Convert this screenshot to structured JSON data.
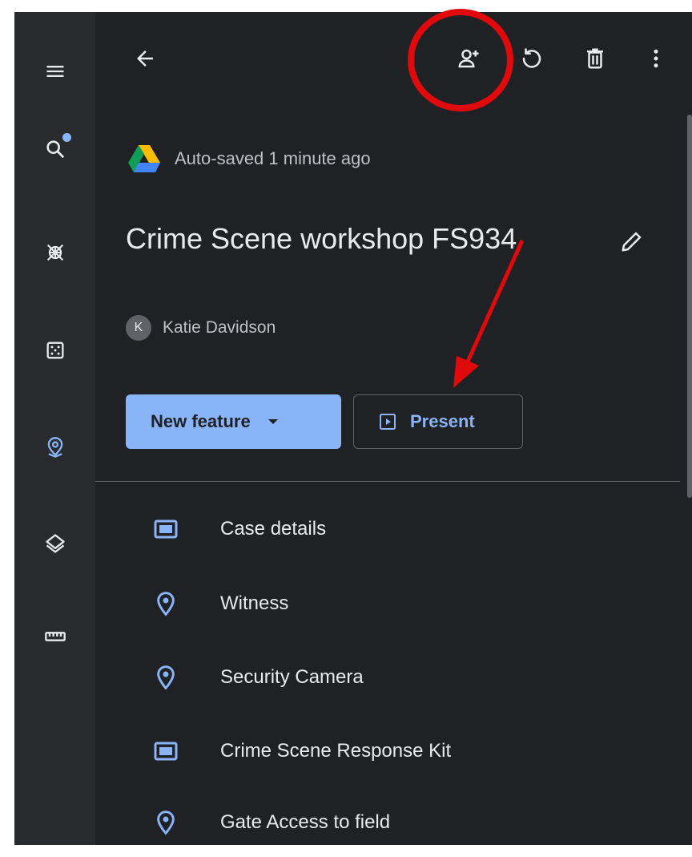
{
  "nav_rail": {
    "items": [
      {
        "name": "menu-icon"
      },
      {
        "name": "search-icon",
        "notification_dot": true
      },
      {
        "name": "satellite-icon"
      },
      {
        "name": "dice-icon"
      },
      {
        "name": "location-icon",
        "active": true
      },
      {
        "name": "layers-icon"
      },
      {
        "name": "ruler-icon"
      }
    ]
  },
  "toolbar": {
    "actions": [
      "back-arrow-icon",
      "share-person-add-icon",
      "history-icon",
      "trash-icon",
      "more-vert-icon"
    ]
  },
  "map": {
    "autosave": "Auto-saved 1 minute ago",
    "title": "Crime Scene workshop FS934",
    "owner_initial": "K",
    "owner": "Katie Davidson"
  },
  "buttons": {
    "new_feature": "New feature",
    "present": "Present"
  },
  "features": [
    {
      "label": "Case details",
      "icon": "rectangle-icon"
    },
    {
      "label": "Witness",
      "icon": "location-pin-icon"
    },
    {
      "label": "Security Camera",
      "icon": "location-pin-icon"
    },
    {
      "label": "Crime Scene Response Kit",
      "icon": "rectangle-icon"
    },
    {
      "label": "Gate Access to field",
      "icon": "location-pin-icon"
    }
  ],
  "colors": {
    "accent": "#8ab4f8",
    "background": "#202124",
    "rail": "#292a2d",
    "annotation": "#e0090b"
  }
}
